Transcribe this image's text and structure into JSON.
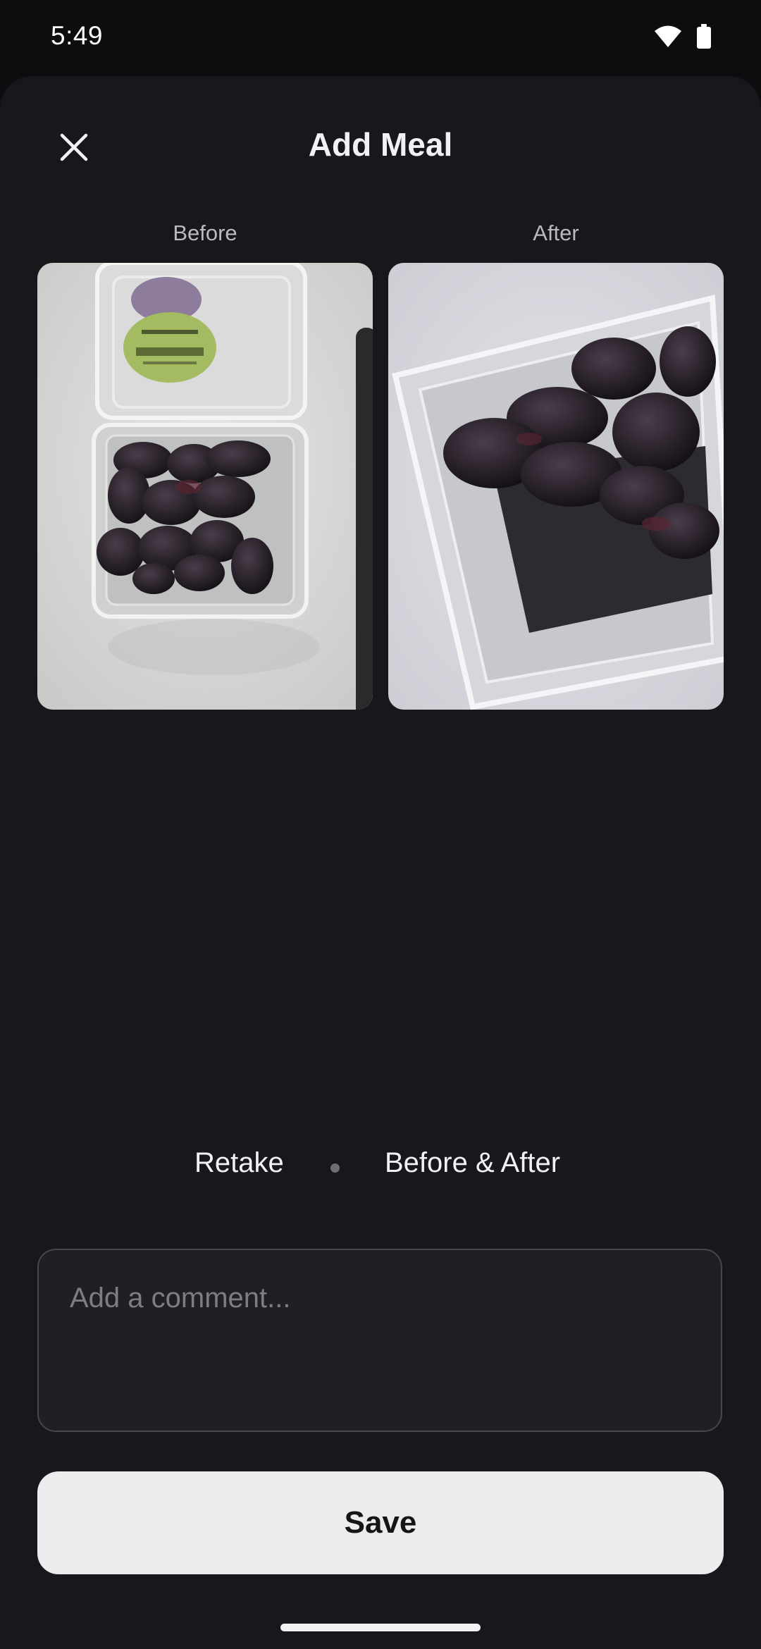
{
  "status_bar": {
    "time": "5:49",
    "icons": [
      "wifi-icon",
      "battery-icon"
    ]
  },
  "header": {
    "title": "Add Meal",
    "close_icon": "close-icon"
  },
  "photos": {
    "before": {
      "label": "Before"
    },
    "after": {
      "label": "After"
    }
  },
  "actions": {
    "retake": "Retake",
    "before_after": "Before & After"
  },
  "comment": {
    "placeholder": "Add a comment...",
    "value": ""
  },
  "save_label": "Save",
  "colors": {
    "background": "#17181b",
    "surface": "#1f2023",
    "button": "#ececef",
    "text": "#f1f1f3",
    "muted": "#b9babe"
  }
}
